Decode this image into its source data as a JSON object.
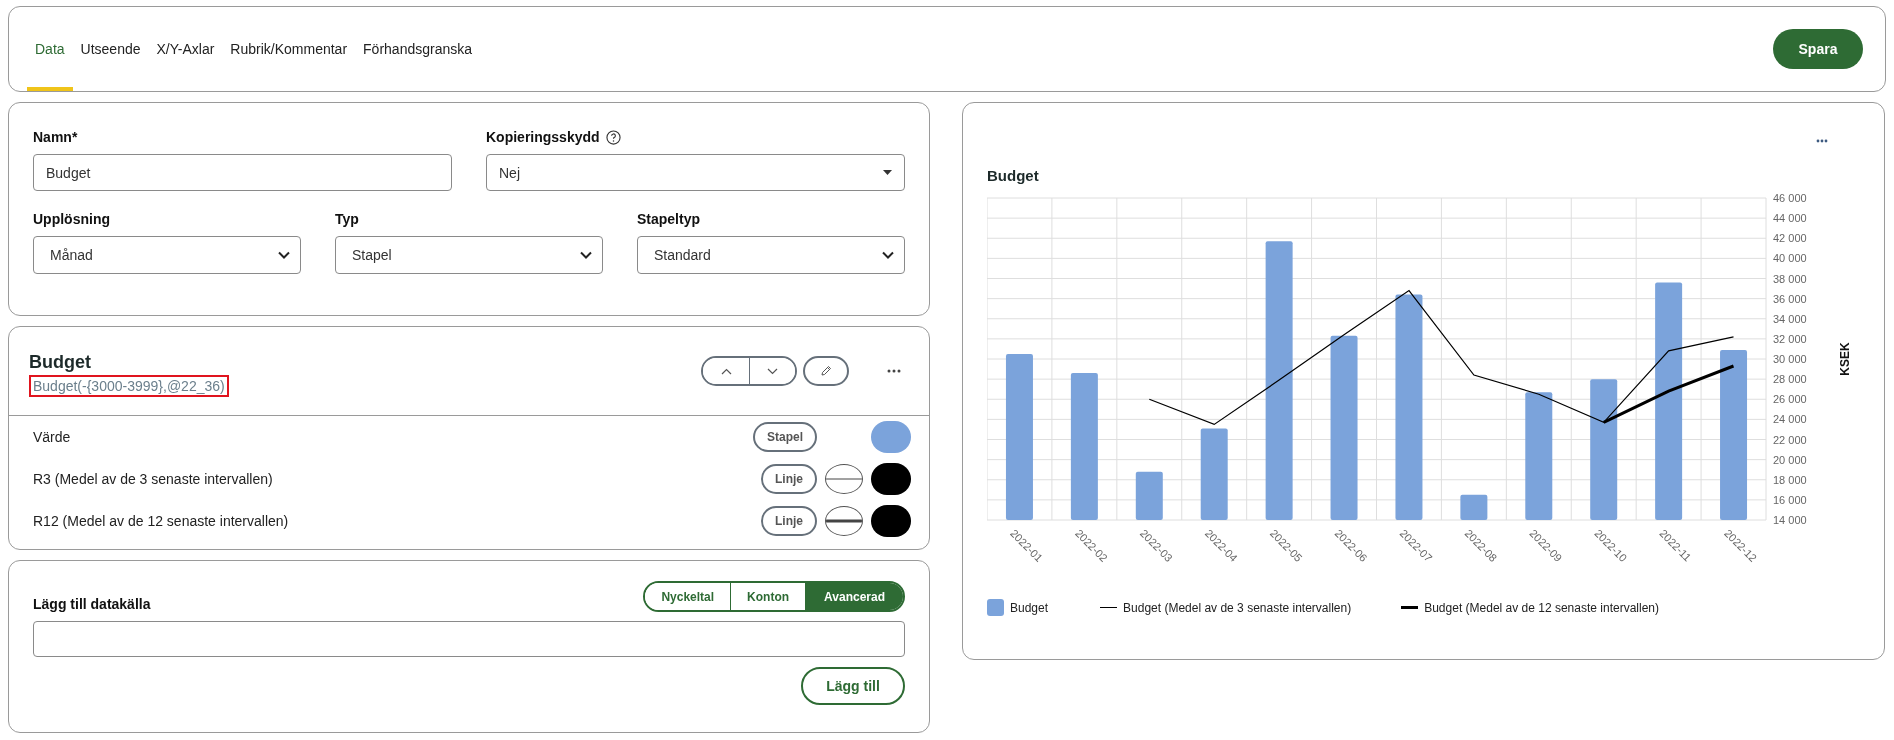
{
  "tabs": [
    {
      "label": "Data",
      "selected": true
    },
    {
      "label": "Utseende",
      "selected": false
    },
    {
      "label": "X/Y-Axlar",
      "selected": false
    },
    {
      "label": "Rubrik/Kommentar",
      "selected": false
    },
    {
      "label": "Förhandsgranska",
      "selected": false
    }
  ],
  "save_button": "Spara",
  "form": {
    "name": {
      "label": "Namn*",
      "value": "Budget"
    },
    "copy_protection": {
      "label": "Kopieringsskydd",
      "value": "Nej"
    },
    "selects": [
      {
        "label": "Upplösning",
        "value": "Månad"
      },
      {
        "label": "Typ",
        "value": "Stapel"
      },
      {
        "label": "Stapeltyp",
        "value": "Standard"
      }
    ]
  },
  "series": {
    "title": "Budget",
    "formula": "Budget(-{3000-3999},@22_36)",
    "formula_highlighted": true,
    "rows": [
      {
        "label": "Värde",
        "kind": "bar",
        "type_button": "Stapel",
        "color": "#7ba3db"
      },
      {
        "label": "R3 (Medel av de 3 senaste intervallen)",
        "kind": "line",
        "type_button": "Linje",
        "thick": false,
        "color": "#000000"
      },
      {
        "label": "R12 (Medel av de 12 senaste intervallen)",
        "kind": "line",
        "type_button": "Linje",
        "thick": true,
        "color": "#000000"
      }
    ]
  },
  "add_source": {
    "label": "Lägg till datakälla",
    "modes": [
      {
        "label": "Nyckeltal",
        "selected": false
      },
      {
        "label": "Konton",
        "selected": false
      },
      {
        "label": "Avancerad",
        "selected": true
      }
    ],
    "button": "Lägg till"
  },
  "chart_card": {
    "chart_data": {
      "type": "bar",
      "title": "Budget",
      "ylabel": "KSEK",
      "stacked": false,
      "grid": true,
      "legend": "bottom",
      "categories": [
        "2022-01",
        "2022-02",
        "2022-03",
        "2022-04",
        "2022-05",
        "2022-06",
        "2022-07",
        "2022-08",
        "2022-09",
        "2022-10",
        "2022-11",
        "2022-12"
      ],
      "series": [
        {
          "name": "Budget",
          "color": "#7ba3db",
          "values": [
            30500,
            28600,
            18800,
            23100,
            41700,
            32300,
            36400,
            16500,
            26700,
            28000,
            37600,
            30900
          ]
        },
        {
          "name": "Budget (Medel av de 3 senaste intervallen)",
          "type": "line",
          "color": "#000000",
          "values": [
            null,
            null,
            26000,
            23500,
            27900,
            32400,
            36800,
            28400,
            26500,
            23700,
            30800,
            32200
          ]
        },
        {
          "name": "Budget (Medel av de 12 senaste intervallen)",
          "type": "line",
          "color": "#000000",
          "values": [
            null,
            null,
            null,
            null,
            null,
            null,
            null,
            null,
            null,
            23700,
            26800,
            29300
          ]
        }
      ],
      "ylim": [
        14000,
        46000
      ],
      "yticks": [
        {
          "value": 14000,
          "label": "14 000"
        },
        {
          "value": 16000,
          "label": "16 000"
        },
        {
          "value": 18000,
          "label": "18 000"
        },
        {
          "value": 20000,
          "label": "20 000"
        },
        {
          "value": 22000,
          "label": "22 000"
        },
        {
          "value": 24000,
          "label": "24 000"
        },
        {
          "value": 26000,
          "label": "26 000"
        },
        {
          "value": 28000,
          "label": "28 000"
        },
        {
          "value": 30000,
          "label": "30 000"
        },
        {
          "value": 32000,
          "label": "32 000"
        },
        {
          "value": 34000,
          "label": "34 000"
        },
        {
          "value": 36000,
          "label": "36 000"
        },
        {
          "value": 38000,
          "label": "38 000"
        },
        {
          "value": 40000,
          "label": "40 000"
        },
        {
          "value": 42000,
          "label": "42 000"
        },
        {
          "value": 44000,
          "label": "44 000"
        },
        {
          "value": 46000,
          "label": "46 000"
        }
      ]
    }
  }
}
